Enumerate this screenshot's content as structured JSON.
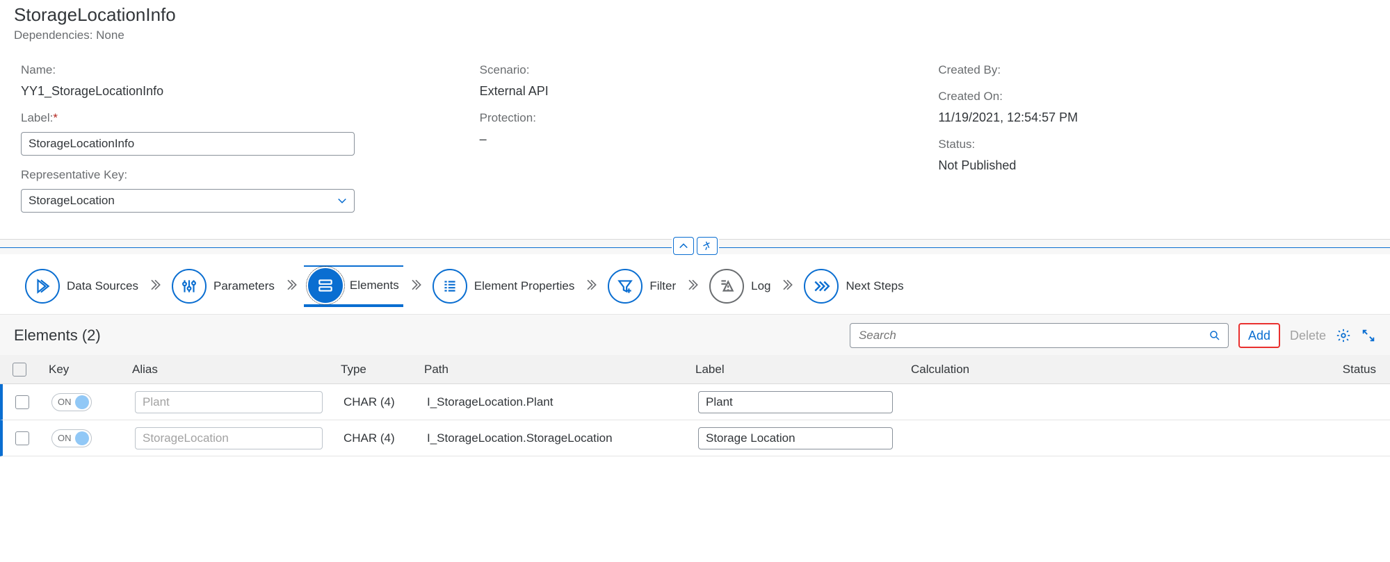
{
  "header": {
    "title": "StorageLocationInfo",
    "dependencies_label": "Dependencies: None"
  },
  "form": {
    "name_label": "Name:",
    "name_value": "YY1_StorageLocationInfo",
    "label_label": "Label:",
    "label_value": "StorageLocationInfo",
    "repkey_label": "Representative Key:",
    "repkey_value": "StorageLocation",
    "scenario_label": "Scenario:",
    "scenario_value": "External API",
    "protection_label": "Protection:",
    "protection_value": "–",
    "createdby_label": "Created By:",
    "createdby_value": "",
    "createdon_label": "Created On:",
    "createdon_value": "11/19/2021, 12:54:57 PM",
    "status_label": "Status:",
    "status_value": "Not Published"
  },
  "wizard": {
    "steps": {
      "data_sources": "Data Sources",
      "parameters": "Parameters",
      "elements": "Elements",
      "element_properties": "Element Properties",
      "filter": "Filter",
      "log": "Log",
      "next_steps": "Next Steps"
    }
  },
  "elements": {
    "title": "Elements (2)",
    "search_placeholder": "Search",
    "add_label": "Add",
    "delete_label": "Delete"
  },
  "columns": {
    "key": "Key",
    "alias": "Alias",
    "type": "Type",
    "path": "Path",
    "label": "Label",
    "calculation": "Calculation",
    "status": "Status"
  },
  "rows": [
    {
      "key_on": "ON",
      "alias": "Plant",
      "type": "CHAR (4)",
      "path": "I_StorageLocation.Plant",
      "label": "Plant"
    },
    {
      "key_on": "ON",
      "alias": "StorageLocation",
      "type": "CHAR (4)",
      "path": "I_StorageLocation.StorageLocation",
      "label": "Storage Location"
    }
  ]
}
